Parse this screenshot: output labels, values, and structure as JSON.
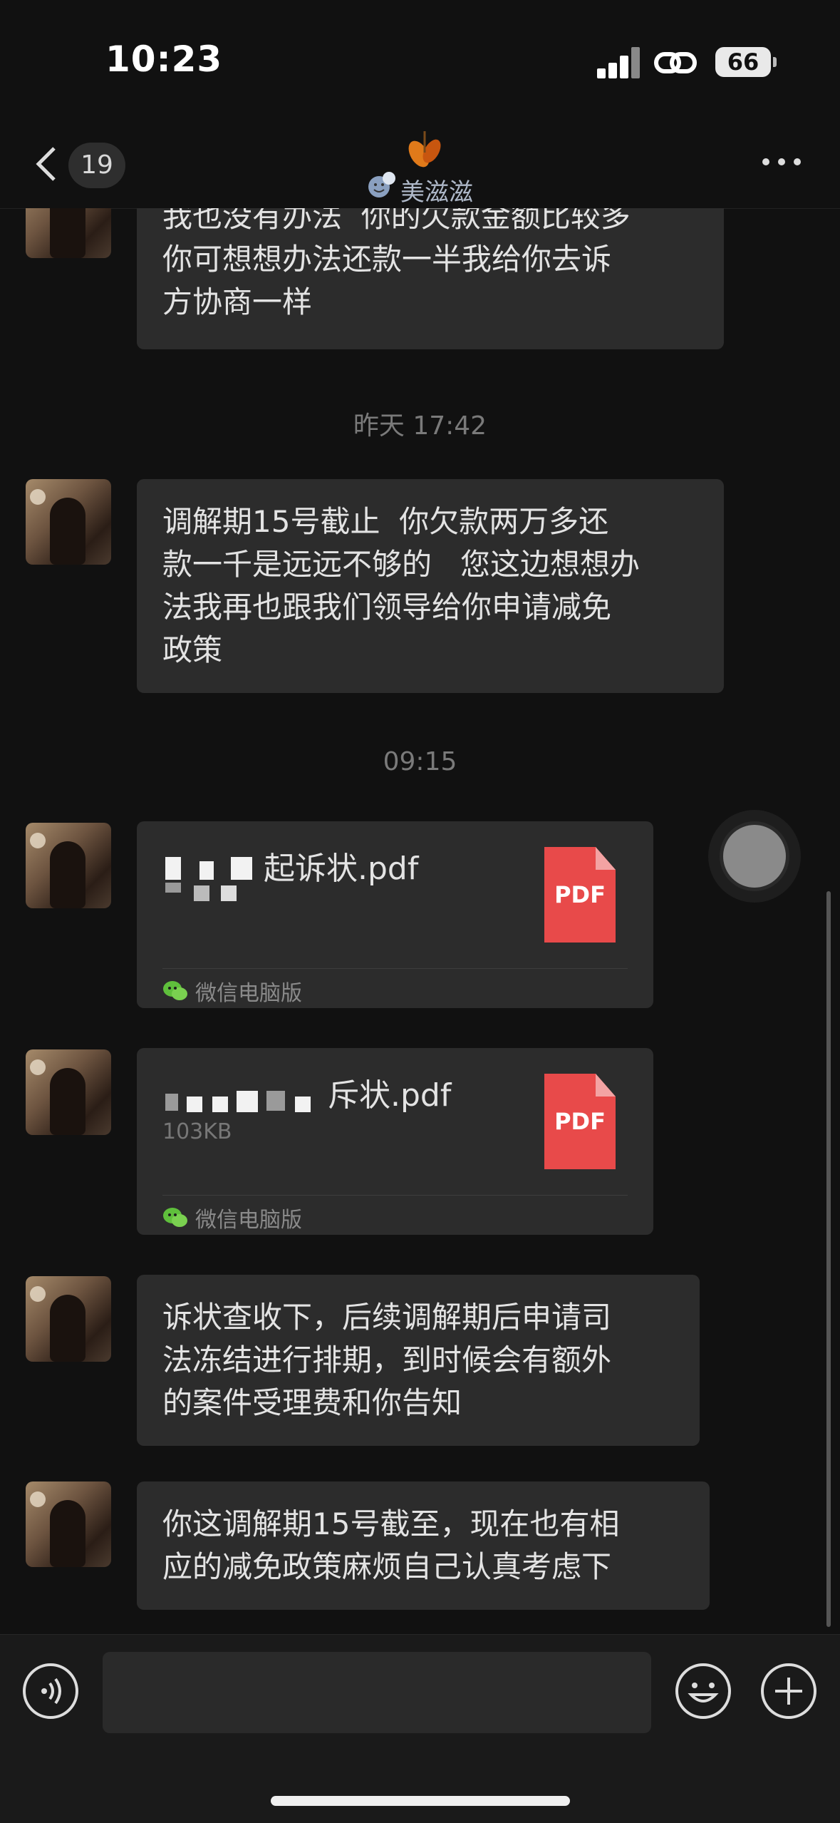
{
  "status_bar": {
    "time": "10:23",
    "battery": "66"
  },
  "nav": {
    "unread_count": "19",
    "title": "美滋滋"
  },
  "messages": [
    {
      "type": "text",
      "text": "我也没有办法  你的欠款金额比较多\n你可想想办法还款一半我给你去诉\n方协商一样"
    },
    {
      "type": "timestamp",
      "text": "昨天 17:42"
    },
    {
      "type": "text",
      "text": "调解期15号截止  你欠款两万多还\n款一千是远远不够的   您这边想想办\n法我再也跟我们领导给你申请减免\n政策"
    },
    {
      "type": "timestamp",
      "text": "09:15"
    },
    {
      "type": "file",
      "name": "起诉状.pdf",
      "size": "",
      "icon_label": "PDF",
      "source": "微信电脑版"
    },
    {
      "type": "file",
      "name": "斥状.pdf",
      "size": "103KB",
      "icon_label": "PDF",
      "source": "微信电脑版"
    },
    {
      "type": "text",
      "text": "诉状查收下，后续调解期后申请司\n法冻结进行排期，到时候会有额外\n的案件受理费和你告知"
    },
    {
      "type": "text",
      "text": "你这调解期15号截至，现在也有相\n应的减免政策麻烦自己认真考虑下"
    }
  ],
  "input": {
    "placeholder": "",
    "value": ""
  },
  "colors": {
    "background": "#111111",
    "bubble": "#2c2c2c",
    "pdf_red": "#e84a4a"
  },
  "icons": [
    "back-icon",
    "more-icon",
    "pdf-icon",
    "wechat-icon",
    "voice-icon",
    "emoji-icon",
    "plus-icon"
  ]
}
